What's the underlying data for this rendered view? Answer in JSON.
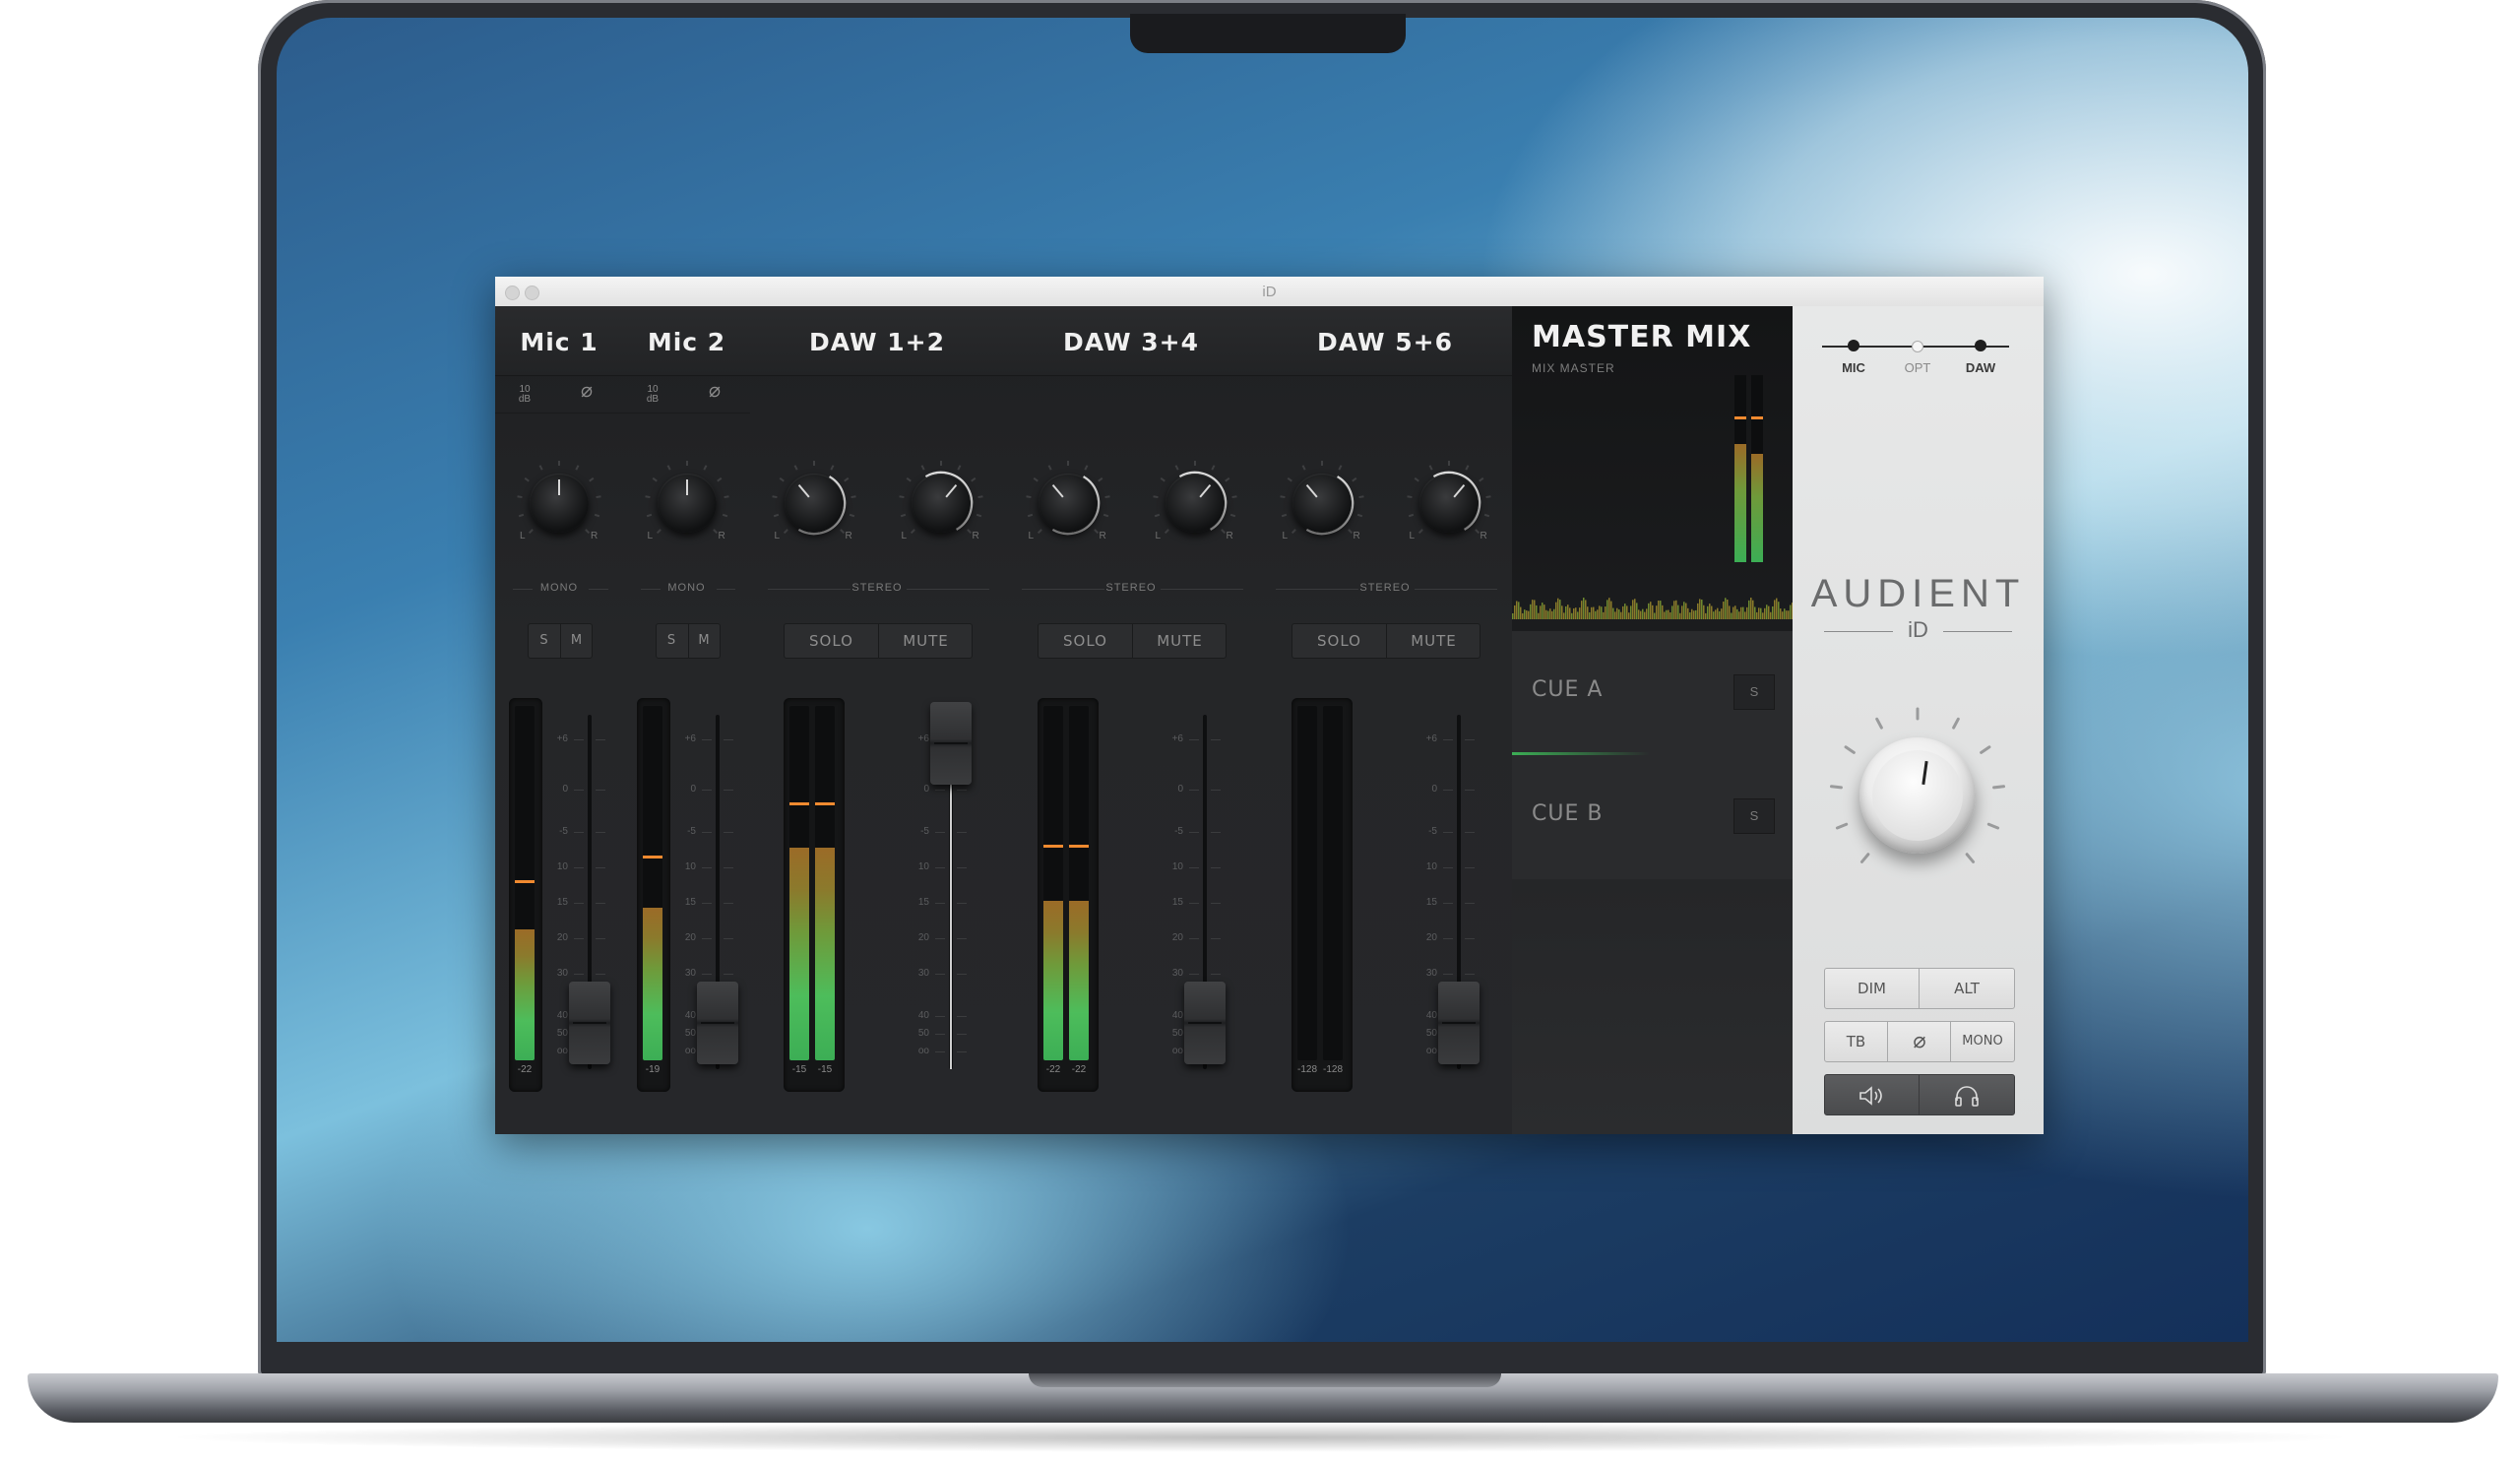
{
  "window": {
    "title": "iD"
  },
  "channels": [
    {
      "name": "Mic 1",
      "gain": "10\ndB",
      "mode": "MONO",
      "solo": "S",
      "mute": "M",
      "meters": [
        "-22"
      ]
    },
    {
      "name": "Mic 2",
      "gain": "10\ndB",
      "mode": "MONO",
      "solo": "S",
      "mute": "M",
      "meters": [
        "-19"
      ]
    },
    {
      "name": "DAW 1+2",
      "mode": "STEREO",
      "solo": "SOLO",
      "mute": "MUTE",
      "meters": [
        "-15",
        "-15"
      ]
    },
    {
      "name": "DAW 3+4",
      "mode": "STEREO",
      "solo": "SOLO",
      "mute": "MUTE",
      "meters": [
        "-22",
        "-22"
      ]
    },
    {
      "name": "DAW 5+6",
      "mode": "STEREO",
      "solo": "SOLO",
      "mute": "MUTE",
      "meters": [
        "-128",
        "-128"
      ]
    }
  ],
  "pan_labels": {
    "left": "L",
    "right": "R"
  },
  "fader_scale": [
    "+6",
    "0",
    "-5",
    "10",
    "15",
    "20",
    "30",
    "40",
    "50",
    "oo"
  ],
  "master": {
    "title": "MASTER MIX",
    "subtitle": "MIX MASTER"
  },
  "cues": [
    {
      "label": "CUE A",
      "solo": "S"
    },
    {
      "label": "CUE B",
      "solo": "S"
    }
  ],
  "source_selector": {
    "options": [
      "MIC",
      "OPT",
      "DAW"
    ]
  },
  "brand": {
    "name": "AUDIENT",
    "model": "iD"
  },
  "monitor_buttons": {
    "dim": "DIM",
    "alt": "ALT",
    "tb": "TB",
    "mono": "MONO"
  },
  "colors": {
    "accent_orange": "#f08a30",
    "meter_green": "#3cae55",
    "panel_light": "#e2e3e3"
  }
}
